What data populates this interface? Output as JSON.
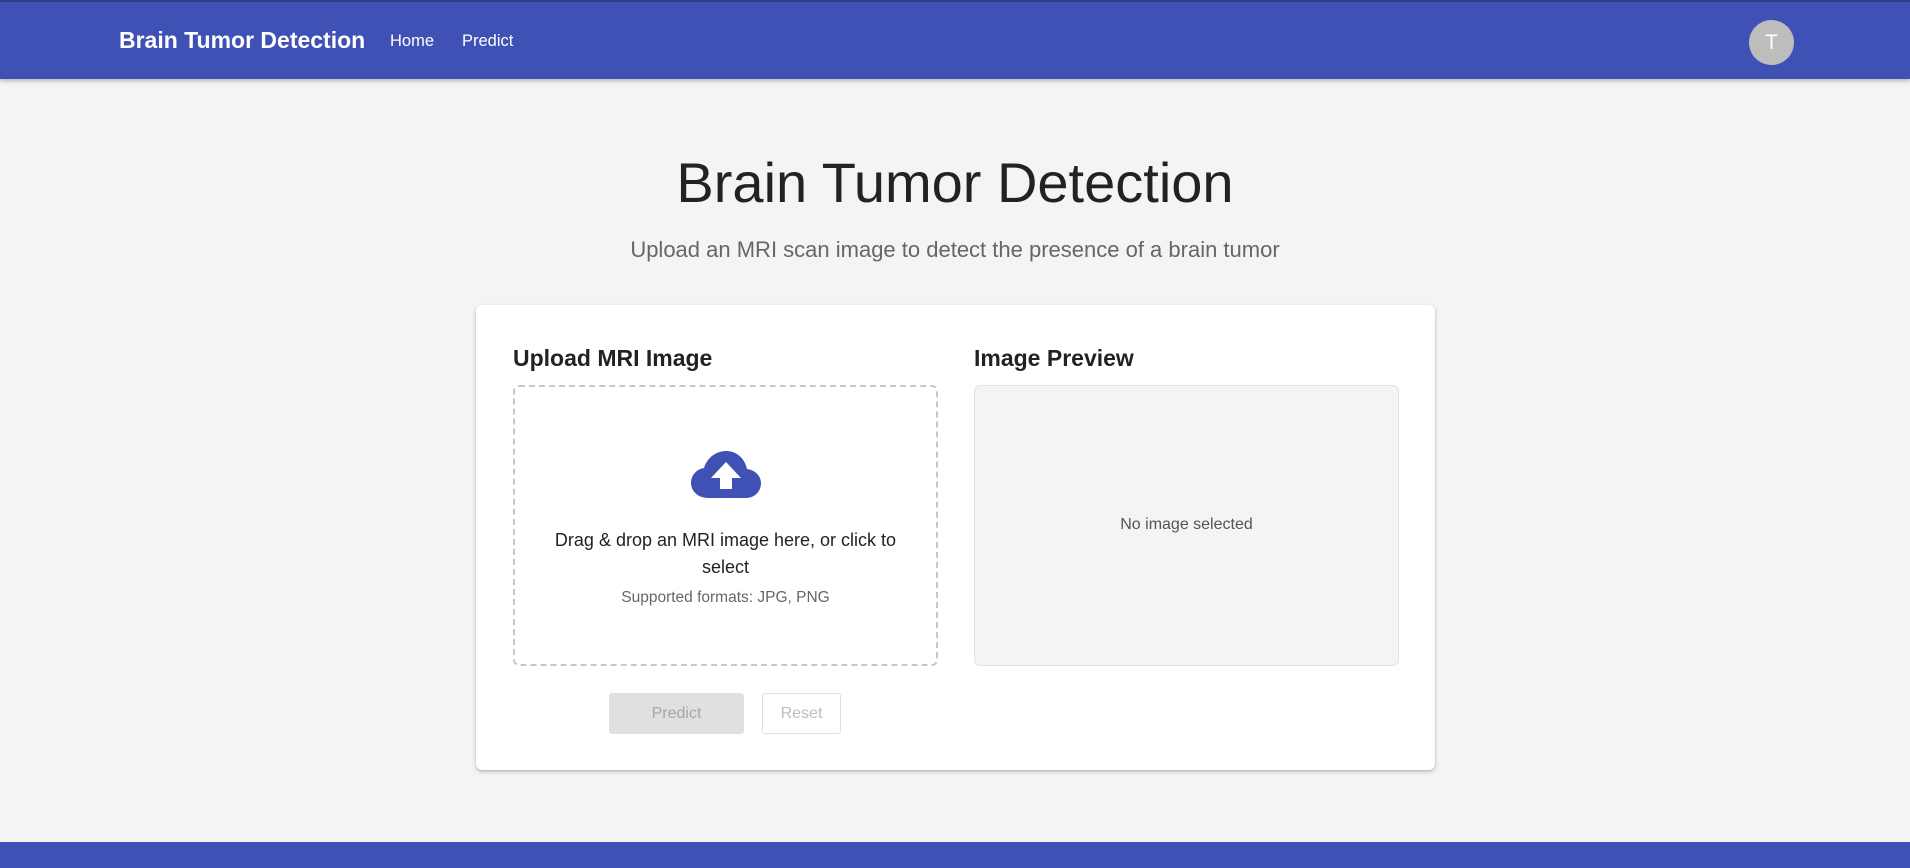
{
  "header": {
    "brand": "Brain Tumor Detection",
    "nav": {
      "home": "Home",
      "predict": "Predict"
    },
    "avatar_initial": "T"
  },
  "main": {
    "title": "Brain Tumor Detection",
    "subtitle": "Upload an MRI scan image to detect the presence of a brain tumor"
  },
  "upload": {
    "heading": "Upload MRI Image",
    "icon": "cloud-upload-icon",
    "drop_text": "Drag & drop an MRI image here, or click to select",
    "formats": "Supported formats: JPG, PNG"
  },
  "preview": {
    "heading": "Image Preview",
    "empty_text": "No image selected"
  },
  "actions": {
    "predict_label": "Predict",
    "reset_label": "Reset"
  },
  "colors": {
    "primary": "#3f51b5",
    "background": "#f4f4f4",
    "disabled_button": "#e0e0e0"
  }
}
